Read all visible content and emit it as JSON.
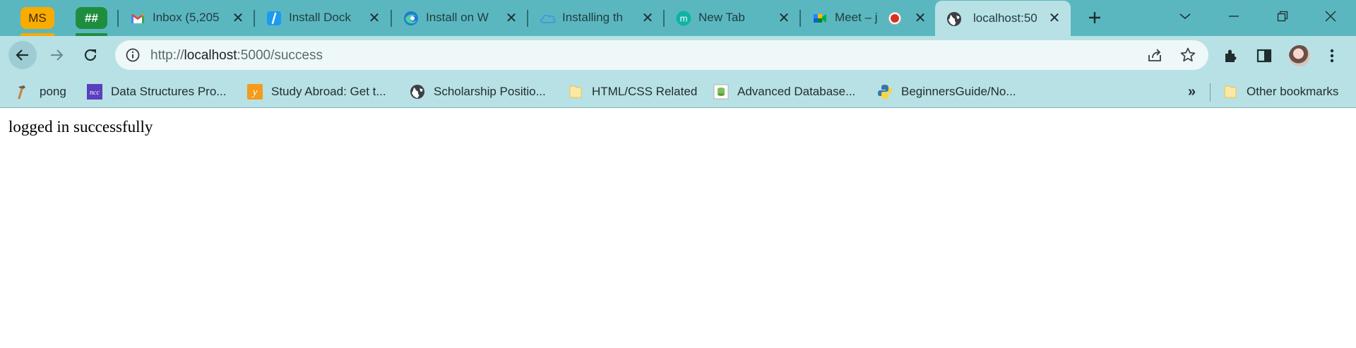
{
  "tab_groups": [
    {
      "label": "MS",
      "color": "#f9ab00"
    },
    {
      "label": "##",
      "color": "#1e8e3e"
    }
  ],
  "tabs": [
    {
      "title": "Inbox (5,205",
      "icon": "gmail-icon",
      "active": false
    },
    {
      "title": "Install Dock",
      "icon": "docs-slash-icon",
      "active": false
    },
    {
      "title": "Install on W",
      "icon": "edge-icon",
      "active": false
    },
    {
      "title": "Installing th",
      "icon": "cloud-icon",
      "active": false
    },
    {
      "title": "New Tab",
      "icon": "m-icon",
      "active": false
    },
    {
      "title": "Meet – j",
      "icon": "meet-icon",
      "active": false,
      "recording": true
    },
    {
      "title": "localhost:50",
      "icon": "globe-icon",
      "active": true
    }
  ],
  "toolbar": {
    "url_host": "localhost",
    "url_prefix": "http://",
    "url_suffix": ":5000/success"
  },
  "bookmarks": [
    {
      "label": "pong",
      "icon": "hammer-icon"
    },
    {
      "label": "Data Structures Pro...",
      "icon": "purple-logo-icon"
    },
    {
      "label": "Study Abroad: Get t...",
      "icon": "orange-logo-icon"
    },
    {
      "label": "Scholarship Positio...",
      "icon": "globe-icon"
    },
    {
      "label": "HTML/CSS Related",
      "icon": "folder-icon"
    },
    {
      "label": "Advanced Database...",
      "icon": "db-icon"
    },
    {
      "label": "BeginnersGuide/No...",
      "icon": "python-icon"
    }
  ],
  "bookmarks_more": "»",
  "other_bookmarks": "Other bookmarks",
  "page": {
    "text": "logged in successfully"
  },
  "colors": {
    "tabstrip": "#5bb7bf",
    "toolbar": "#b8e1e5",
    "omnibox": "#eef8f9"
  }
}
